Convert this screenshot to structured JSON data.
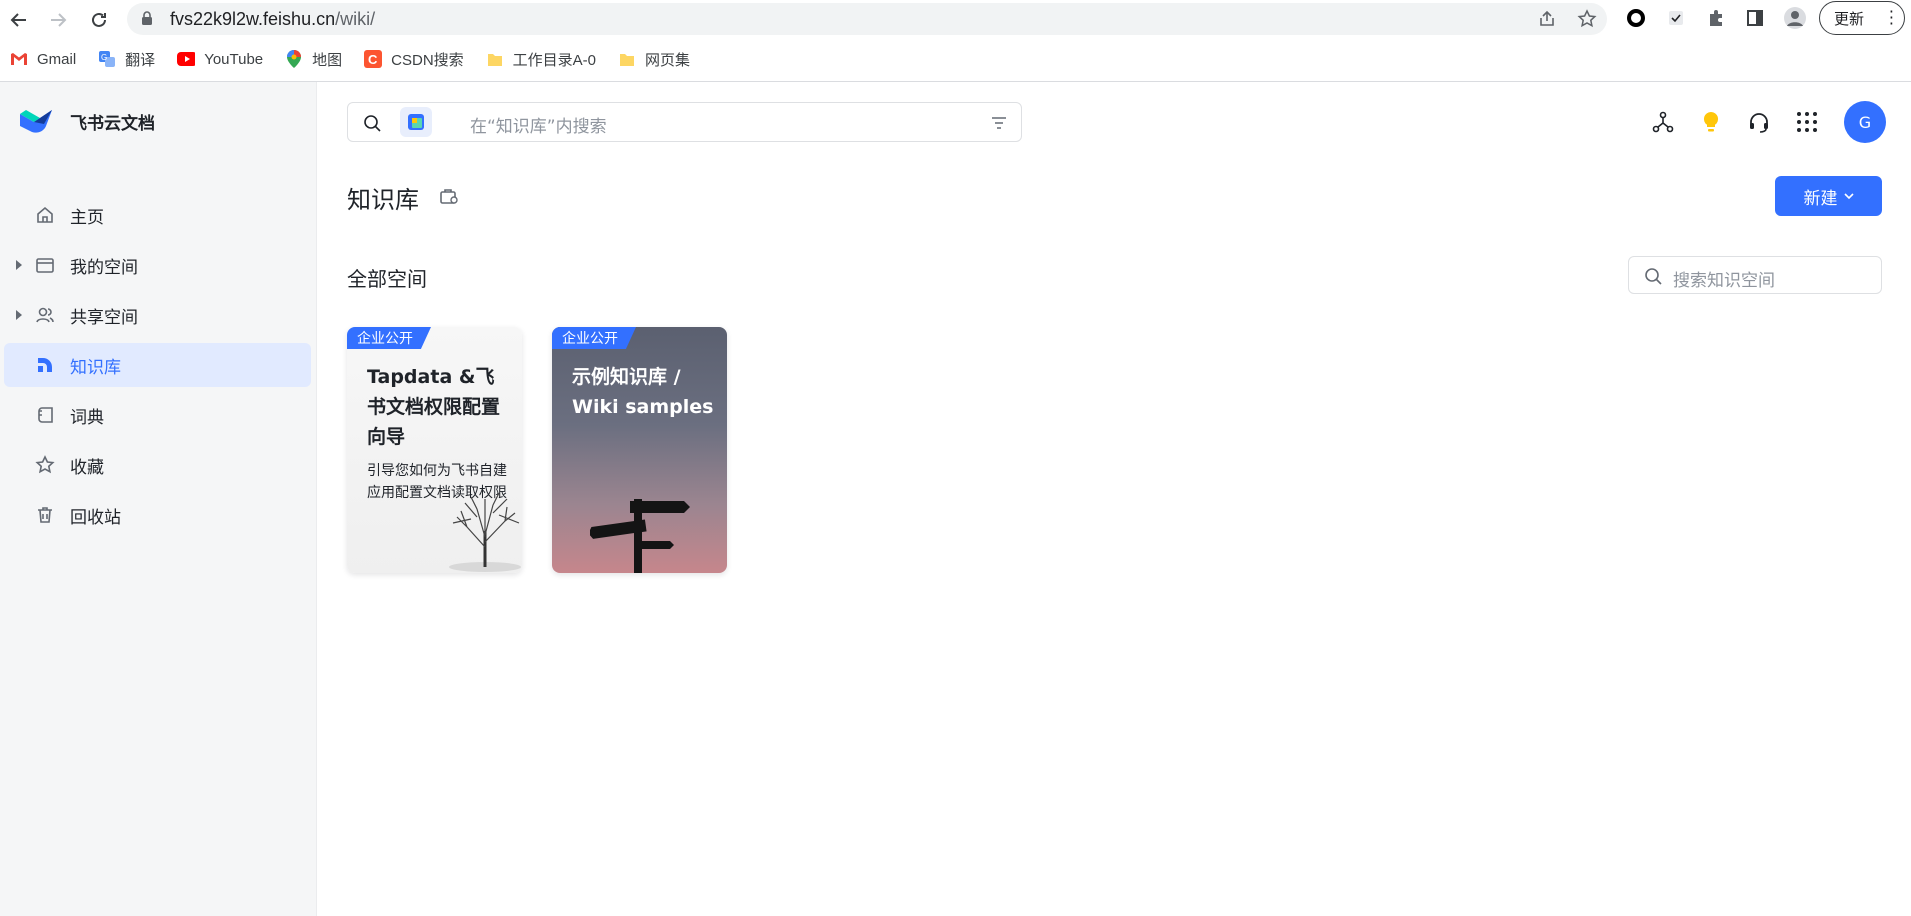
{
  "browser": {
    "url_host": "fvs22k9l2w.feishu.cn",
    "url_path": "/wiki/",
    "update_label": "更新",
    "bookmarks": [
      {
        "label": "Gmail",
        "icon": "gmail-icon"
      },
      {
        "label": "翻译",
        "icon": "translate-icon"
      },
      {
        "label": "YouTube",
        "icon": "youtube-icon"
      },
      {
        "label": "地图",
        "icon": "maps-icon"
      },
      {
        "label": "CSDN搜索",
        "icon": "csdn-icon"
      },
      {
        "label": "工作目录A-0",
        "icon": "folder-icon"
      },
      {
        "label": "网页集",
        "icon": "folder-icon"
      }
    ]
  },
  "app": {
    "brand": "飞书云文档",
    "accent": "#3370ff"
  },
  "sidebar": {
    "items": [
      {
        "label": "主页",
        "icon": "home-icon"
      },
      {
        "label": "我的空间",
        "icon": "folder-icon"
      },
      {
        "label": "共享空间",
        "icon": "users-icon"
      },
      {
        "label": "知识库",
        "icon": "wiki-icon"
      },
      {
        "label": "词典",
        "icon": "dictionary-icon"
      },
      {
        "label": "收藏",
        "icon": "star-icon"
      },
      {
        "label": "回收站",
        "icon": "trash-icon"
      }
    ]
  },
  "header": {
    "search_placeholder": "在“知识库”内搜索",
    "avatar_letter": "G"
  },
  "page": {
    "title": "知识库",
    "new_button": "新建",
    "section_title": "全部空间",
    "space_search_placeholder": "搜索知识空间"
  },
  "spaces": [
    {
      "badge": "企业公开",
      "title": "Tapdata &飞书文档权限配置向导",
      "desc": "引导您如何为飞书自建应用配置文档读取权限"
    },
    {
      "badge": "企业公开",
      "title": "示例知识库 / Wiki samples",
      "desc": ""
    }
  ]
}
